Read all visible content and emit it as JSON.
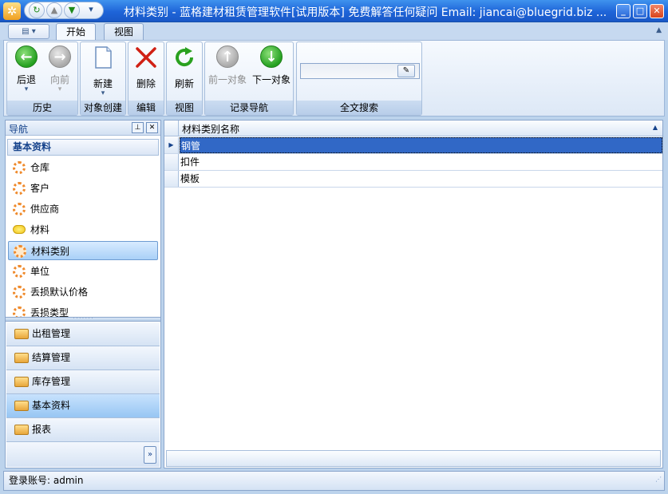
{
  "window": {
    "title": "材料类别 - 蓝格建材租赁管理软件[试用版本] 免费解答任何疑问 Email: jiancai@bluegrid.biz ...",
    "min": "_",
    "max": "□",
    "close": "✕"
  },
  "tabs": [
    {
      "label": "开始"
    },
    {
      "label": "视图"
    }
  ],
  "ribbon": {
    "groups": [
      {
        "label": "历史",
        "buttons": [
          {
            "label": "后退"
          },
          {
            "label": "向前"
          }
        ]
      },
      {
        "label": "对象创建",
        "buttons": [
          {
            "label": "新建"
          }
        ]
      },
      {
        "label": "编辑",
        "buttons": [
          {
            "label": "删除"
          }
        ]
      },
      {
        "label": "视图",
        "buttons": [
          {
            "label": "刷新"
          }
        ]
      },
      {
        "label": "记录导航",
        "buttons": [
          {
            "label": "前一对象"
          },
          {
            "label": "下一对象"
          }
        ]
      },
      {
        "label": "全文搜索",
        "search_value": ""
      }
    ]
  },
  "nav": {
    "title": "导航",
    "section": "基本资料",
    "items": [
      {
        "label": "仓库"
      },
      {
        "label": "客户"
      },
      {
        "label": "供应商"
      },
      {
        "label": "材料"
      },
      {
        "label": "材料类别"
      },
      {
        "label": "单位"
      },
      {
        "label": "丢损默认价格"
      },
      {
        "label": "丢损类型"
      }
    ],
    "selected_item": "材料类别",
    "categories": [
      {
        "label": "出租管理"
      },
      {
        "label": "结算管理"
      },
      {
        "label": "库存管理"
      },
      {
        "label": "基本资料"
      },
      {
        "label": "报表"
      }
    ],
    "selected_category": "基本资料"
  },
  "grid": {
    "column": "材料类别名称",
    "rows": [
      {
        "value": "钢管"
      },
      {
        "value": "扣件"
      },
      {
        "value": "模板"
      }
    ],
    "selected_row": 0
  },
  "status": {
    "text": "登录账号: admin"
  },
  "colors": {
    "titlebar": "#1e64d8",
    "selection": "#3168c6",
    "accent": "#15428b"
  }
}
